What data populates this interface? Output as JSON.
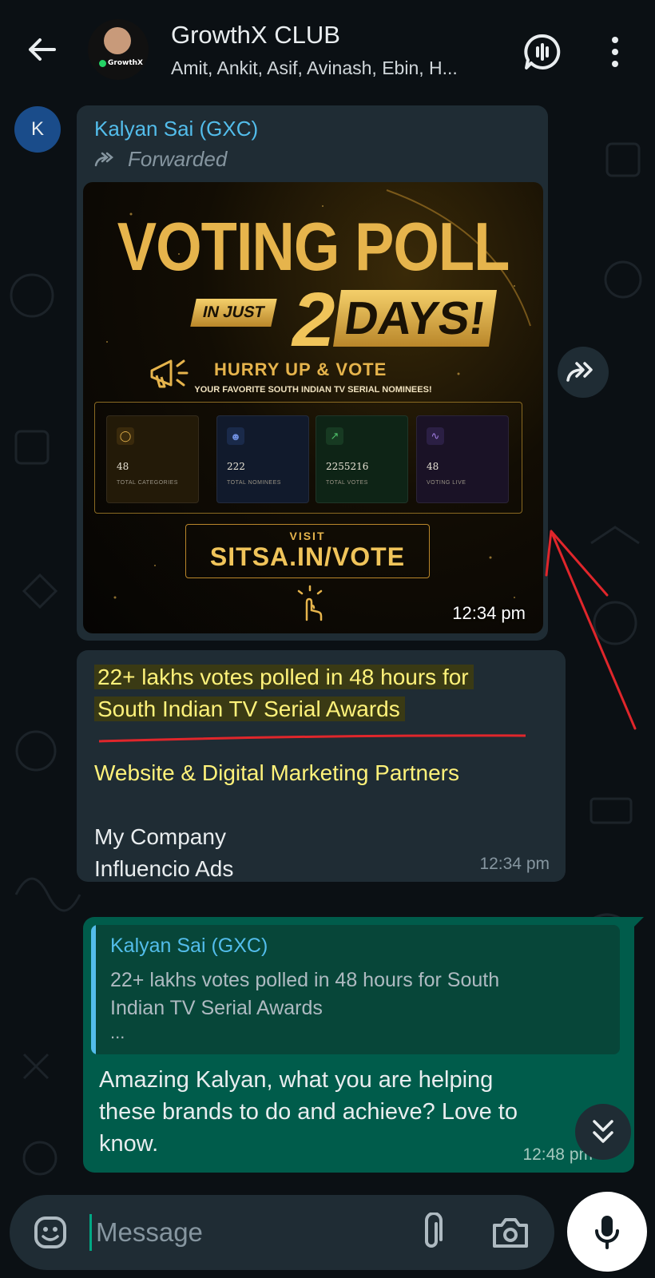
{
  "header": {
    "title": "GrowthX CLUB",
    "subtitle": "Amit, Ankit, Asif, Avinash, Ebin, H...",
    "avatar_text": "GrowthX"
  },
  "messages": {
    "first": {
      "avatar_letter": "K",
      "sender": "Kalyan Sai (GXC)",
      "forwarded_label": "Forwarded",
      "time": "12:34 pm",
      "poster": {
        "title": "VOTING POLL",
        "in_just": "IN JUST",
        "number": "2",
        "days": "DAYS!",
        "hurry": "HURRY UP & VOTE",
        "favorite": "YOUR FAVORITE SOUTH INDIAN TV SERIAL NOMINEES!",
        "stats": [
          {
            "value": "48",
            "label": "TOTAL CATEGORIES",
            "color": "#e6b44c"
          },
          {
            "value": "222",
            "label": "TOTAL NOMINEES",
            "color": "#6f8fe0"
          },
          {
            "value": "2255216",
            "label": "TOTAL VOTES",
            "color": "#4fc26a"
          },
          {
            "value": "48",
            "label": "VOTING LIVE",
            "color": "#a07de0"
          }
        ],
        "visit": "VISIT",
        "url": "SITSA.IN/VOTE"
      }
    },
    "second": {
      "line1": "22+ lakhs votes polled in 48 hours for",
      "line2": "South Indian TV Serial Awards",
      "line3": "Website & Digital Marketing Partners",
      "line4": "My Company",
      "line5": "Influencio Ads",
      "time": "12:34 pm"
    },
    "outgoing": {
      "quote_sender": "Kalyan Sai (GXC)",
      "quote_line1": "22+ lakhs votes polled in 48 hours for South",
      "quote_line2": "Indian TV Serial Awards",
      "quote_ellipsis": "...",
      "text_line1": "Amazing Kalyan, what you are helping",
      "text_line2": "these brands to  do and achieve? Love to",
      "text_line3": "know.",
      "time": "12:48 pm"
    }
  },
  "input": {
    "placeholder": "Message"
  },
  "colors": {
    "accent": "#00a884",
    "incoming_bubble": "#1f2c34",
    "outgoing_bubble": "#005c4b",
    "link_blue": "#53bdeb",
    "highlight": "#fff27a",
    "annotation_red": "#e0262b"
  },
  "icons": [
    "back-arrow-icon",
    "voice-chat-icon",
    "more-options-icon",
    "forward-icon",
    "share-icon",
    "scroll-down-icon",
    "emoji-icon",
    "attach-icon",
    "camera-icon",
    "mic-icon"
  ]
}
